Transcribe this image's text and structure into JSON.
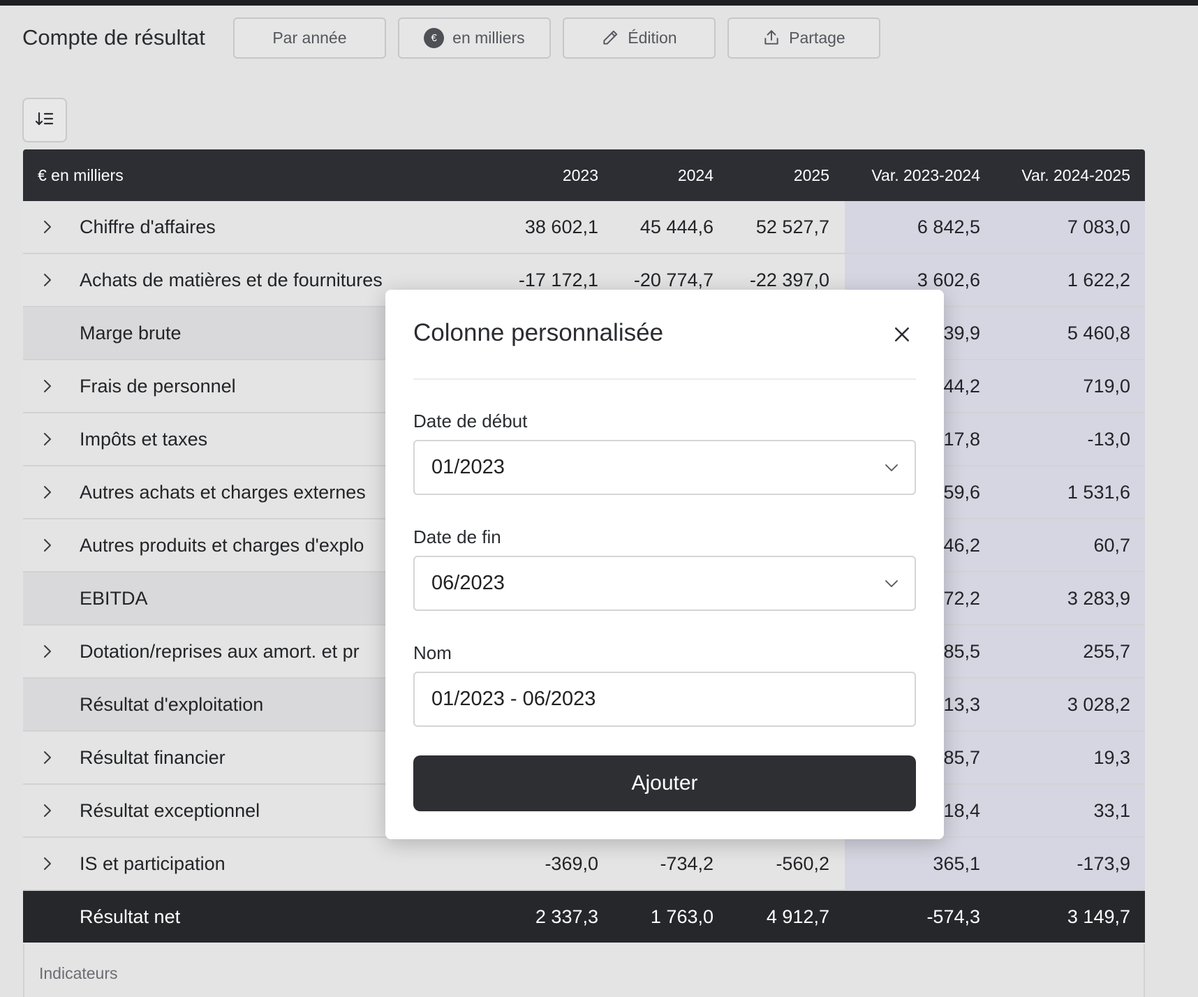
{
  "header": {
    "title": "Compte de résultat",
    "buttons": {
      "period": "Par année",
      "unit": "en milliers",
      "unit_badge": "€",
      "edit": "Édition",
      "share": "Partage"
    }
  },
  "table": {
    "columns": [
      "€ en milliers",
      "2023",
      "2024",
      "2025",
      "Var. 2023-2024",
      "Var. 2024-2025"
    ],
    "rows": [
      {
        "label": "Chiffre d'affaires",
        "values": [
          "38 602,1",
          "45 444,6",
          "52 527,7",
          "6 842,5",
          "7 083,0"
        ]
      },
      {
        "label": "Achats de matières et de fournitures",
        "values": [
          "-17 172,1",
          "-20 774,7",
          "-22 397,0",
          "3 602,6",
          "1 622,2"
        ]
      },
      {
        "label": "Marge brute",
        "values": [
          "",
          "",
          "",
          "39,9",
          "5 460,8"
        ]
      },
      {
        "label": "Frais de personnel",
        "values": [
          "",
          "",
          "",
          "44,2",
          "719,0"
        ]
      },
      {
        "label": "Impôts et taxes",
        "values": [
          "",
          "",
          "",
          "17,8",
          "-13,0"
        ]
      },
      {
        "label": "Autres achats et charges externes",
        "values": [
          "",
          "",
          "",
          "59,6",
          "1 531,6"
        ]
      },
      {
        "label": "Autres produits et charges d'explo",
        "values": [
          "",
          "",
          "",
          "46,2",
          "60,7"
        ]
      },
      {
        "label": "EBITDA",
        "values": [
          "",
          "",
          "",
          "72,2",
          "3 283,9"
        ]
      },
      {
        "label": "Dotation/reprises aux amort. et pr",
        "values": [
          "",
          "",
          "",
          "85,5",
          "255,7"
        ]
      },
      {
        "label": "Résultat d'exploitation",
        "values": [
          "",
          "",
          "",
          "13,3",
          "3 028,2"
        ]
      },
      {
        "label": "Résultat financier",
        "values": [
          "",
          "",
          "",
          "85,7",
          "19,3"
        ]
      },
      {
        "label": "Résultat exceptionnel",
        "values": [
          "",
          "",
          "",
          "18,4",
          "33,1"
        ]
      },
      {
        "label": "IS et participation",
        "values": [
          "-369,0",
          "-734,2",
          "-560,2",
          "365,1",
          "-173,9"
        ]
      }
    ],
    "total": {
      "label": "Résultat net",
      "values": [
        "2 337,3",
        "1 763,0",
        "4 912,7",
        "-574,3",
        "3 149,7"
      ]
    },
    "footer_section": "Indicateurs"
  },
  "modal": {
    "title": "Colonne personnalisée",
    "start_label": "Date de début",
    "start_value": "01/2023",
    "end_label": "Date de fin",
    "end_value": "06/2023",
    "name_label": "Nom",
    "name_value": "01/2023 - 06/2023",
    "submit": "Ajouter"
  }
}
